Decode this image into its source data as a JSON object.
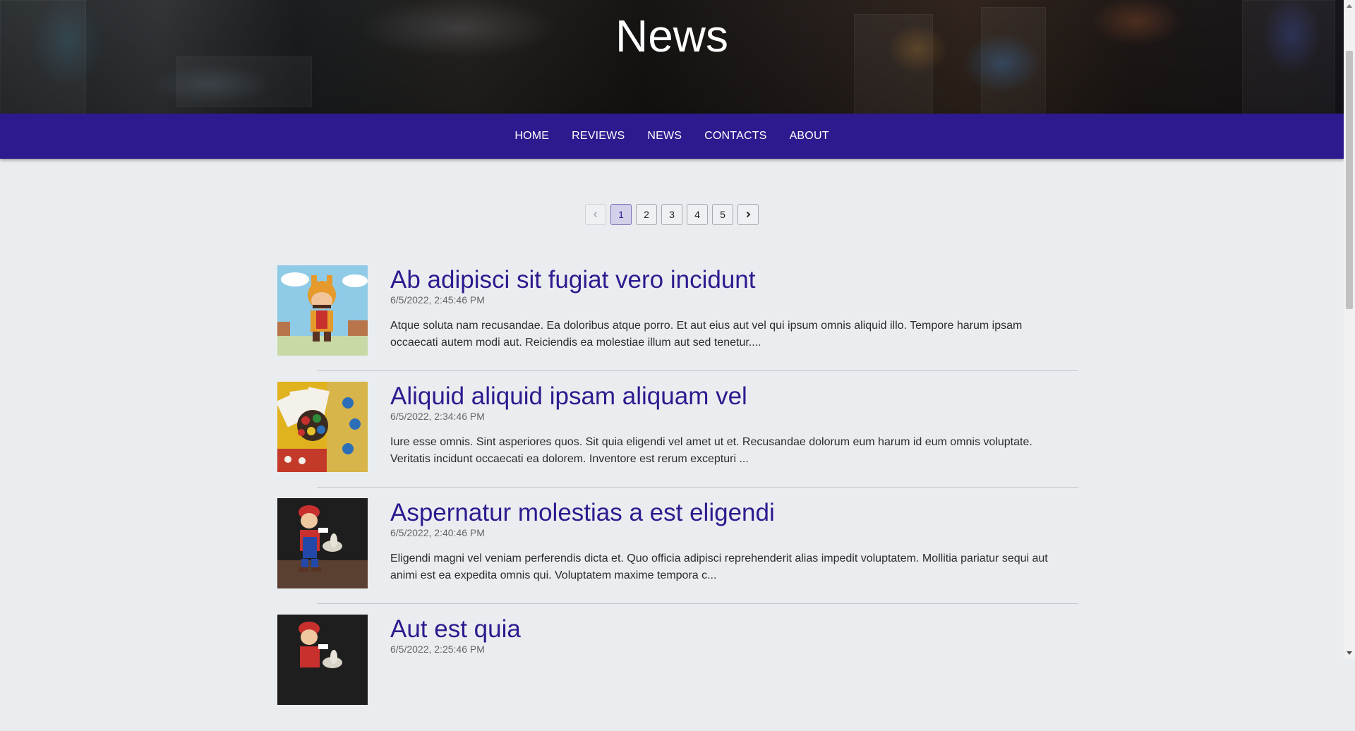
{
  "hero": {
    "title": "News"
  },
  "nav": {
    "items": [
      {
        "label": "HOME"
      },
      {
        "label": "REVIEWS"
      },
      {
        "label": "NEWS"
      },
      {
        "label": "CONTACTS"
      },
      {
        "label": "ABOUT"
      }
    ]
  },
  "pagination": {
    "pages": [
      "1",
      "2",
      "3",
      "4",
      "5"
    ],
    "current": "1"
  },
  "articles": [
    {
      "title": "Ab adipisci sit fugiat vero incidunt",
      "date": "6/5/2022, 2:45:46 PM",
      "excerpt": "Atque soluta nam recusandae. Ea doloribus atque porro. Et aut eius aut vel qui ipsum omnis aliquid illo. Tempore harum ipsam occaecati autem modi aut. Reiciendis ea molestiae illum aut sed tenetur...."
    },
    {
      "title": "Aliquid aliquid ipsam aliquam vel",
      "date": "6/5/2022, 2:34:46 PM",
      "excerpt": "Iure esse omnis. Sint asperiores quos. Sit quia eligendi vel amet ut et. Recusandae dolorum eum harum id eum omnis voluptate. Veritatis incidunt occaecati ea dolorem. Inventore est rerum excepturi ..."
    },
    {
      "title": "Aspernatur molestias a est eligendi",
      "date": "6/5/2022, 2:40:46 PM",
      "excerpt": "Eligendi magni vel veniam perferendis dicta et. Quo officia adipisci reprehenderit alias impedit voluptatem. Mollitia pariatur sequi aut animi est ea expedita omnis qui. Voluptatem maxime tempora c..."
    },
    {
      "title": "Aut est quia",
      "date": "6/5/2022, 2:25:46 PM",
      "excerpt": ""
    }
  ],
  "colors": {
    "nav_background": "#2e1a8f",
    "title_color": "#2e1a8f",
    "page_background": "#eaedf0"
  }
}
